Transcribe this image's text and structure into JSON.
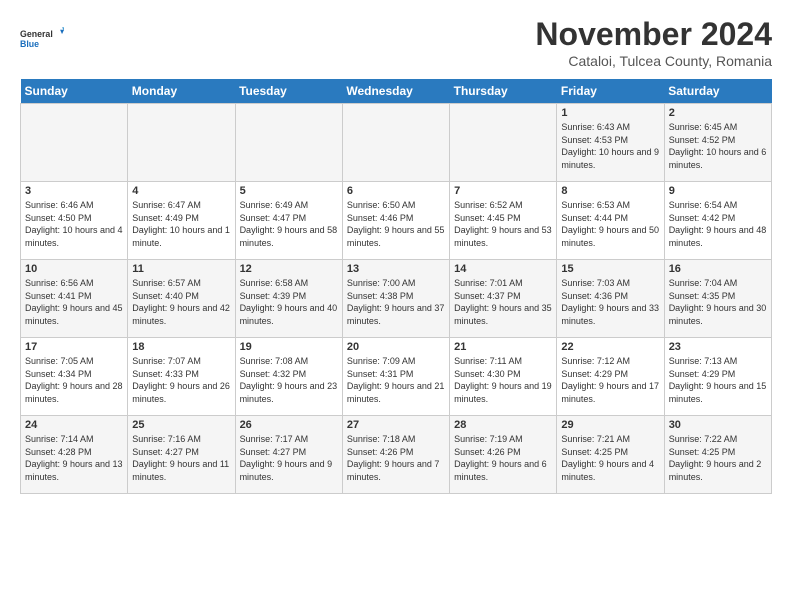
{
  "logo": {
    "general": "General",
    "blue": "Blue"
  },
  "title": "November 2024",
  "subtitle": "Cataloi, Tulcea County, Romania",
  "days_of_week": [
    "Sunday",
    "Monday",
    "Tuesday",
    "Wednesday",
    "Thursday",
    "Friday",
    "Saturday"
  ],
  "weeks": [
    [
      {
        "day": "",
        "info": ""
      },
      {
        "day": "",
        "info": ""
      },
      {
        "day": "",
        "info": ""
      },
      {
        "day": "",
        "info": ""
      },
      {
        "day": "",
        "info": ""
      },
      {
        "day": "1",
        "info": "Sunrise: 6:43 AM\nSunset: 4:53 PM\nDaylight: 10 hours and 9 minutes."
      },
      {
        "day": "2",
        "info": "Sunrise: 6:45 AM\nSunset: 4:52 PM\nDaylight: 10 hours and 6 minutes."
      }
    ],
    [
      {
        "day": "3",
        "info": "Sunrise: 6:46 AM\nSunset: 4:50 PM\nDaylight: 10 hours and 4 minutes."
      },
      {
        "day": "4",
        "info": "Sunrise: 6:47 AM\nSunset: 4:49 PM\nDaylight: 10 hours and 1 minute."
      },
      {
        "day": "5",
        "info": "Sunrise: 6:49 AM\nSunset: 4:47 PM\nDaylight: 9 hours and 58 minutes."
      },
      {
        "day": "6",
        "info": "Sunrise: 6:50 AM\nSunset: 4:46 PM\nDaylight: 9 hours and 55 minutes."
      },
      {
        "day": "7",
        "info": "Sunrise: 6:52 AM\nSunset: 4:45 PM\nDaylight: 9 hours and 53 minutes."
      },
      {
        "day": "8",
        "info": "Sunrise: 6:53 AM\nSunset: 4:44 PM\nDaylight: 9 hours and 50 minutes."
      },
      {
        "day": "9",
        "info": "Sunrise: 6:54 AM\nSunset: 4:42 PM\nDaylight: 9 hours and 48 minutes."
      }
    ],
    [
      {
        "day": "10",
        "info": "Sunrise: 6:56 AM\nSunset: 4:41 PM\nDaylight: 9 hours and 45 minutes."
      },
      {
        "day": "11",
        "info": "Sunrise: 6:57 AM\nSunset: 4:40 PM\nDaylight: 9 hours and 42 minutes."
      },
      {
        "day": "12",
        "info": "Sunrise: 6:58 AM\nSunset: 4:39 PM\nDaylight: 9 hours and 40 minutes."
      },
      {
        "day": "13",
        "info": "Sunrise: 7:00 AM\nSunset: 4:38 PM\nDaylight: 9 hours and 37 minutes."
      },
      {
        "day": "14",
        "info": "Sunrise: 7:01 AM\nSunset: 4:37 PM\nDaylight: 9 hours and 35 minutes."
      },
      {
        "day": "15",
        "info": "Sunrise: 7:03 AM\nSunset: 4:36 PM\nDaylight: 9 hours and 33 minutes."
      },
      {
        "day": "16",
        "info": "Sunrise: 7:04 AM\nSunset: 4:35 PM\nDaylight: 9 hours and 30 minutes."
      }
    ],
    [
      {
        "day": "17",
        "info": "Sunrise: 7:05 AM\nSunset: 4:34 PM\nDaylight: 9 hours and 28 minutes."
      },
      {
        "day": "18",
        "info": "Sunrise: 7:07 AM\nSunset: 4:33 PM\nDaylight: 9 hours and 26 minutes."
      },
      {
        "day": "19",
        "info": "Sunrise: 7:08 AM\nSunset: 4:32 PM\nDaylight: 9 hours and 23 minutes."
      },
      {
        "day": "20",
        "info": "Sunrise: 7:09 AM\nSunset: 4:31 PM\nDaylight: 9 hours and 21 minutes."
      },
      {
        "day": "21",
        "info": "Sunrise: 7:11 AM\nSunset: 4:30 PM\nDaylight: 9 hours and 19 minutes."
      },
      {
        "day": "22",
        "info": "Sunrise: 7:12 AM\nSunset: 4:29 PM\nDaylight: 9 hours and 17 minutes."
      },
      {
        "day": "23",
        "info": "Sunrise: 7:13 AM\nSunset: 4:29 PM\nDaylight: 9 hours and 15 minutes."
      }
    ],
    [
      {
        "day": "24",
        "info": "Sunrise: 7:14 AM\nSunset: 4:28 PM\nDaylight: 9 hours and 13 minutes."
      },
      {
        "day": "25",
        "info": "Sunrise: 7:16 AM\nSunset: 4:27 PM\nDaylight: 9 hours and 11 minutes."
      },
      {
        "day": "26",
        "info": "Sunrise: 7:17 AM\nSunset: 4:27 PM\nDaylight: 9 hours and 9 minutes."
      },
      {
        "day": "27",
        "info": "Sunrise: 7:18 AM\nSunset: 4:26 PM\nDaylight: 9 hours and 7 minutes."
      },
      {
        "day": "28",
        "info": "Sunrise: 7:19 AM\nSunset: 4:26 PM\nDaylight: 9 hours and 6 minutes."
      },
      {
        "day": "29",
        "info": "Sunrise: 7:21 AM\nSunset: 4:25 PM\nDaylight: 9 hours and 4 minutes."
      },
      {
        "day": "30",
        "info": "Sunrise: 7:22 AM\nSunset: 4:25 PM\nDaylight: 9 hours and 2 minutes."
      }
    ]
  ]
}
